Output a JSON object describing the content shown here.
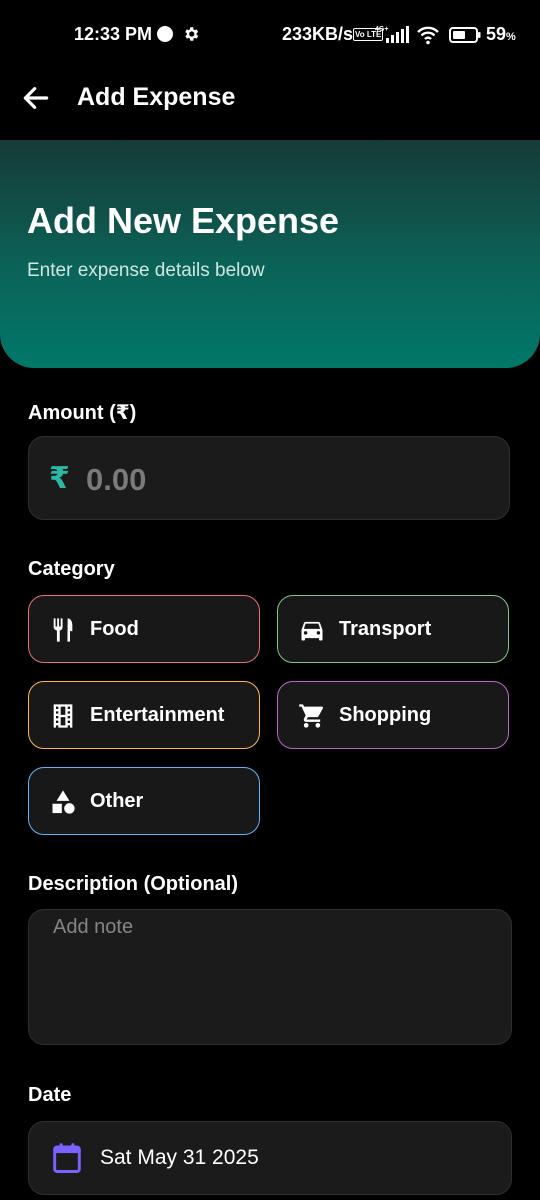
{
  "status_bar": {
    "time": "12:33 PM",
    "speed": "233KB/s",
    "volte": "Vo LTE",
    "network": "4G+",
    "battery_value": "59",
    "battery_unit": "%"
  },
  "app_bar": {
    "title": "Add Expense",
    "back_icon": "back-arrow-icon"
  },
  "header": {
    "title": "Add New Expense",
    "subtitle": "Enter expense details below",
    "gradient_start": "#173a37",
    "gradient_end": "#00786a"
  },
  "amount": {
    "label": "Amount (₹)",
    "currency_symbol": "₹",
    "placeholder": "0.00",
    "value": "",
    "accent": "#2ab7a3"
  },
  "category": {
    "label": "Category",
    "options": [
      {
        "label": "Food",
        "icon": "restaurant-icon",
        "color": "#e57373"
      },
      {
        "label": "Transport",
        "icon": "car-icon",
        "color": "#81c784"
      },
      {
        "label": "Entertainment",
        "icon": "movie-icon",
        "color": "#ffb74d"
      },
      {
        "label": "Shopping",
        "icon": "cart-icon",
        "color": "#ba68c8"
      },
      {
        "label": "Other",
        "icon": "category-shapes-icon",
        "color": "#64b5f6"
      }
    ]
  },
  "description": {
    "label": "Description (Optional)",
    "placeholder": "Add note",
    "value": ""
  },
  "date": {
    "label": "Date",
    "value": "Sat May 31 2025",
    "icon": "calendar-icon",
    "icon_color": "#7b61ff"
  }
}
